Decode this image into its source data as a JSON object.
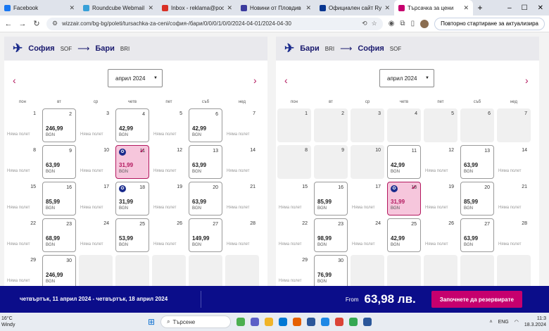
{
  "browser": {
    "tabs": [
      {
        "label": "Facebook",
        "color": "#1877f2"
      },
      {
        "label": "Roundcube Webmail :: Inb",
        "color": "#37a0d8"
      },
      {
        "label": "Inbox - reklama@poctepo",
        "color": "#d93025"
      },
      {
        "label": "Новини от Пловдив - Акт",
        "color": "#3b3b9e"
      },
      {
        "label": "Официален сайт Ryanair",
        "color": "#073590"
      },
      {
        "label": "Търсачка за цени",
        "color": "#c6006e",
        "active": true
      }
    ],
    "new_tab": "+",
    "url": "wizzair.com/bg-bg/poleti/tursachka-za-ceni/софия-/бари/0/0/0/1/0/0/2024-04-01/2024-04-30",
    "restart_label": "Повторно стартиране за актуализира"
  },
  "outbound": {
    "from_city": "София",
    "from_code": "SOF",
    "to_city": "Бари",
    "to_code": "BRI",
    "month": "април 2024",
    "days": [
      {
        "day": "1",
        "type": "nof"
      },
      {
        "day": "2",
        "type": "price",
        "amount": "246,99"
      },
      {
        "day": "3",
        "type": "nof"
      },
      {
        "day": "4",
        "type": "price",
        "amount": "42,99"
      },
      {
        "day": "5",
        "type": "nof"
      },
      {
        "day": "6",
        "type": "price",
        "amount": "42,99"
      },
      {
        "day": "7",
        "type": "nof"
      },
      {
        "day": "8",
        "type": "nof"
      },
      {
        "day": "9",
        "type": "price",
        "amount": "63,99"
      },
      {
        "day": "10",
        "type": "nof"
      },
      {
        "day": "11",
        "type": "selected",
        "amount": "31,99"
      },
      {
        "day": "12",
        "type": "nof"
      },
      {
        "day": "13",
        "type": "price",
        "amount": "63,99"
      },
      {
        "day": "14",
        "type": "nof"
      },
      {
        "day": "15",
        "type": "nof"
      },
      {
        "day": "16",
        "type": "price",
        "amount": "85,99"
      },
      {
        "day": "17",
        "type": "nof"
      },
      {
        "day": "18",
        "type": "badge",
        "amount": "31,99"
      },
      {
        "day": "19",
        "type": "nof"
      },
      {
        "day": "20",
        "type": "price",
        "amount": "63,99"
      },
      {
        "day": "21",
        "type": "nof"
      },
      {
        "day": "22",
        "type": "nof"
      },
      {
        "day": "23",
        "type": "price",
        "amount": "68,99"
      },
      {
        "day": "24",
        "type": "nof"
      },
      {
        "day": "25",
        "type": "price",
        "amount": "53,99"
      },
      {
        "day": "26",
        "type": "nof"
      },
      {
        "day": "27",
        "type": "price",
        "amount": "149,99"
      },
      {
        "day": "28",
        "type": "nof"
      },
      {
        "day": "29",
        "type": "nof"
      },
      {
        "day": "30",
        "type": "price",
        "amount": "246,99"
      },
      {
        "day": "",
        "type": "disabled"
      },
      {
        "day": "",
        "type": "disabled"
      },
      {
        "day": "",
        "type": "disabled"
      },
      {
        "day": "",
        "type": "disabled"
      },
      {
        "day": "",
        "type": "disabled"
      }
    ]
  },
  "inbound": {
    "from_city": "Бари",
    "from_code": "BRI",
    "to_city": "София",
    "to_code": "SOF",
    "month": "април 2024",
    "days": [
      {
        "day": "1",
        "type": "disabled"
      },
      {
        "day": "2",
        "type": "disabled"
      },
      {
        "day": "3",
        "type": "disabled"
      },
      {
        "day": "4",
        "type": "disabled"
      },
      {
        "day": "5",
        "type": "disabled"
      },
      {
        "day": "6",
        "type": "disabled"
      },
      {
        "day": "7",
        "type": "disabled"
      },
      {
        "day": "8",
        "type": "disabled"
      },
      {
        "day": "9",
        "type": "disabled"
      },
      {
        "day": "10",
        "type": "disabled"
      },
      {
        "day": "11",
        "type": "price",
        "amount": "42,99"
      },
      {
        "day": "12",
        "type": "nof"
      },
      {
        "day": "13",
        "type": "price",
        "amount": "63,99"
      },
      {
        "day": "14",
        "type": "nof"
      },
      {
        "day": "15",
        "type": "nof"
      },
      {
        "day": "16",
        "type": "price",
        "amount": "85,99"
      },
      {
        "day": "17",
        "type": "nof"
      },
      {
        "day": "18",
        "type": "selected-badge",
        "amount": "31,99"
      },
      {
        "day": "19",
        "type": "nof"
      },
      {
        "day": "20",
        "type": "price",
        "amount": "85,99"
      },
      {
        "day": "21",
        "type": "nof"
      },
      {
        "day": "22",
        "type": "nof"
      },
      {
        "day": "23",
        "type": "price",
        "amount": "98,99"
      },
      {
        "day": "24",
        "type": "nof"
      },
      {
        "day": "25",
        "type": "price",
        "amount": "42,99"
      },
      {
        "day": "26",
        "type": "nof"
      },
      {
        "day": "27",
        "type": "price",
        "amount": "63,99"
      },
      {
        "day": "28",
        "type": "nof"
      },
      {
        "day": "29",
        "type": "nof"
      },
      {
        "day": "30",
        "type": "price",
        "amount": "76,99"
      },
      {
        "day": "",
        "type": "disabled"
      },
      {
        "day": "",
        "type": "disabled"
      },
      {
        "day": "",
        "type": "disabled"
      },
      {
        "day": "",
        "type": "disabled"
      },
      {
        "day": "",
        "type": "disabled"
      }
    ]
  },
  "calendar": {
    "weekdays": [
      "пон",
      "вт",
      "ср",
      "четв",
      "пет",
      "съб",
      "нед"
    ],
    "currency": "BGN",
    "no_flight": "Няма полет"
  },
  "footer": {
    "dates": "четвъртък, 11 април 2024 - четвъртък, 18 април 2024",
    "from_label": "From",
    "total": "63,98 лв.",
    "book_label": "Започнете да резервирате"
  },
  "taskbar": {
    "temp": "16°C",
    "weather": "Windy",
    "search": "Търсене",
    "lang": "ENG",
    "time": "11:3",
    "date": "18.3.2024"
  },
  "colors": {
    "brand_pink": "#c6006e",
    "brand_navy": "#0b0d8a"
  }
}
